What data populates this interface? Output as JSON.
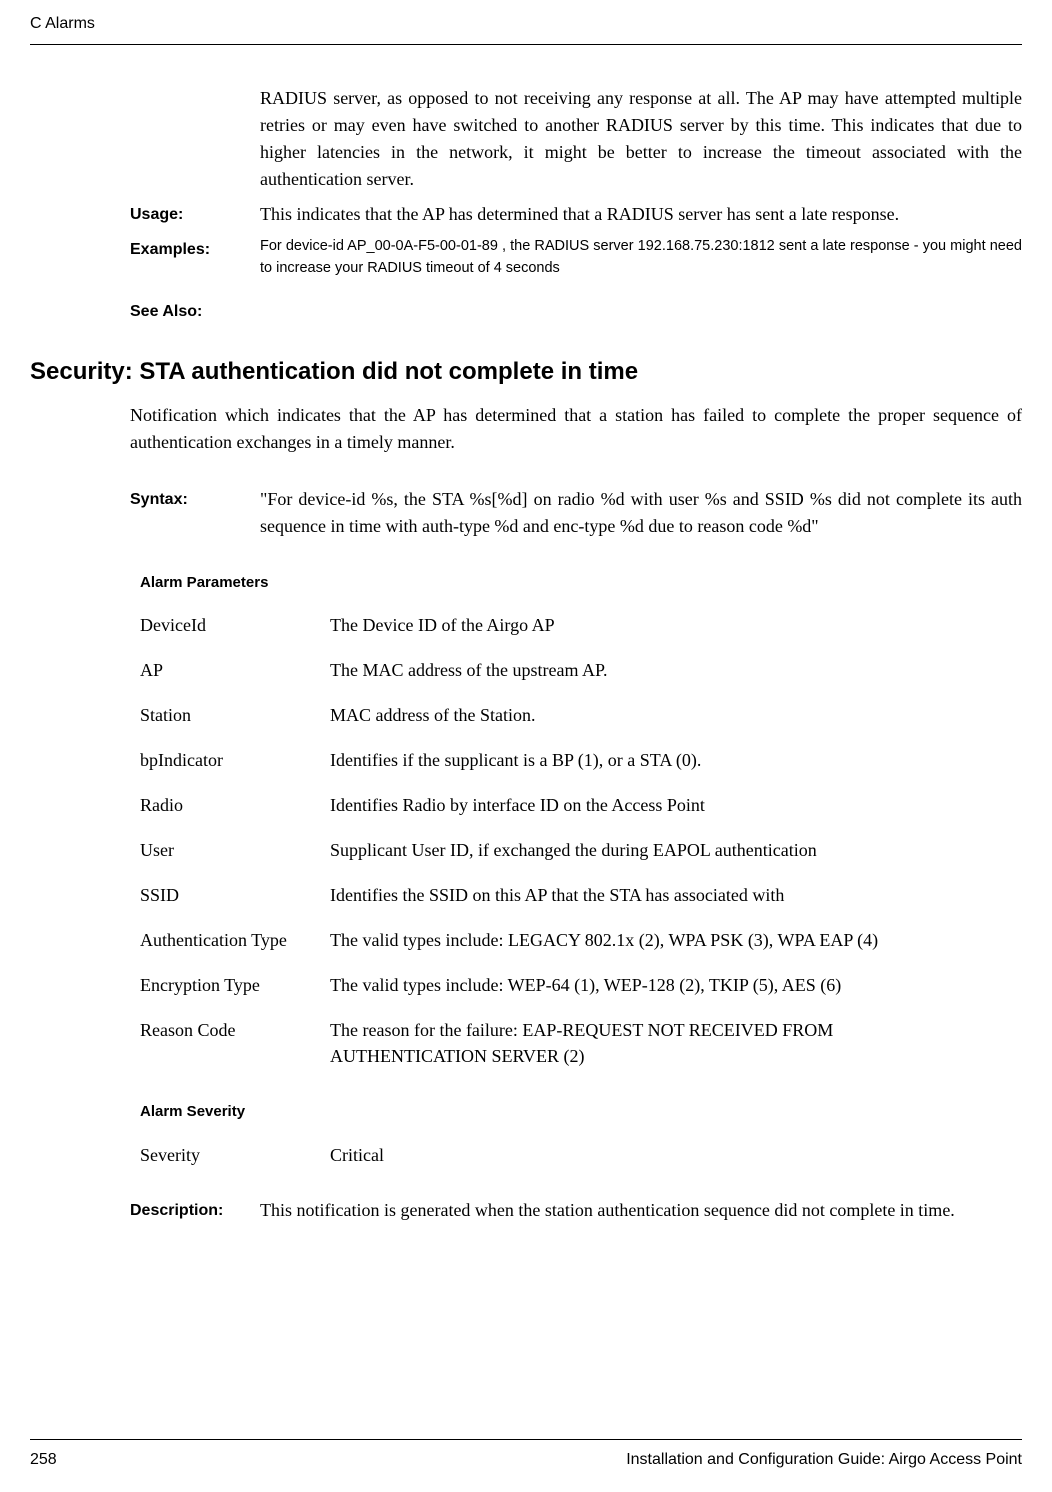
{
  "header": {
    "left": "C  Alarms"
  },
  "topBlock": {
    "continuation": "RADIUS server, as opposed to not receiving any response at all. The AP may have attempted multiple retries or may even have switched to another RADIUS server by this time. This indicates that due to higher latencies in the network, it might be better to increase the timeout associated with the authentication server.",
    "usageLabel": "Usage:",
    "usageText": "This indicates that the AP has determined that a RADIUS server has sent a late response.",
    "examplesLabel": "Examples:",
    "examplesText": "For device-id AP_00-0A-F5-00-01-89 , the RADIUS server 192.168.75.230:1812 sent a late response - you might need to increase your RADIUS timeout of 4 seconds",
    "seeAlsoLabel": "See Also:"
  },
  "section": {
    "heading": "Security: STA authentication did not complete in time",
    "intro": "Notification which indicates that the AP has determined that a station has failed to complete the proper sequence of authentication exchanges in a timely manner.",
    "syntaxLabel": "Syntax:",
    "syntaxText": "\"For device-id %s, the STA %s[%d] on radio %d with user %s and SSID %s did not complete its auth sequence in time with auth-type %d and enc-type %d due to reason code %d\""
  },
  "alarmParams": {
    "heading": "Alarm Parameters",
    "rows": [
      {
        "name": "DeviceId",
        "desc": "The Device ID of the Airgo AP"
      },
      {
        "name": "AP",
        "desc": "The MAC address of the upstream AP."
      },
      {
        "name": "Station",
        "desc": "MAC address of the Station."
      },
      {
        "name": "bpIndicator",
        "desc": "Identifies if the supplicant is a BP (1), or a STA (0)."
      },
      {
        "name": "Radio",
        "desc": "Identifies Radio by interface ID on the Access Point"
      },
      {
        "name": "User",
        "desc": "Supplicant User ID, if exchanged the during EAPOL authentication"
      },
      {
        "name": "SSID",
        "desc": "Identifies the SSID on this AP that the STA has associated with"
      },
      {
        "name": "Authentication Type",
        "desc": "The valid types include: LEGACY 802.1x (2), WPA PSK (3), WPA EAP (4)"
      },
      {
        "name": "Encryption Type",
        "desc": "The valid types include:  WEP-64 (1), WEP-128 (2), TKIP (5), AES (6)"
      },
      {
        "name": "Reason Code",
        "desc": "The reason for the failure: EAP-REQUEST NOT RECEIVED FROM AUTHENTICATION SERVER (2)"
      }
    ]
  },
  "alarmSeverity": {
    "heading": "Alarm Severity",
    "label": "Severity",
    "value": "Critical"
  },
  "description": {
    "label": "Description:",
    "text": "This notification is generated when the station authentication sequence did not complete in time."
  },
  "footer": {
    "pageNum": "258",
    "guideTitle": "Installation and Configuration Guide: Airgo Access Point"
  }
}
